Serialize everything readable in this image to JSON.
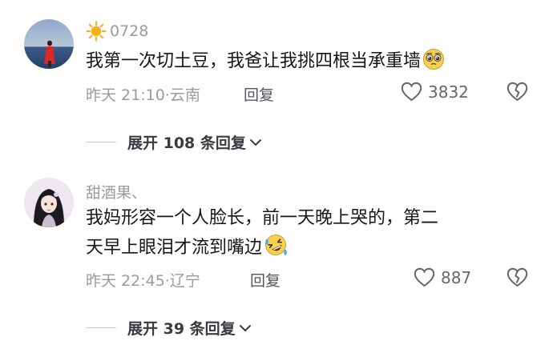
{
  "comments": [
    {
      "username": "0728",
      "username_icon": "sun-icon",
      "text": "我第一次切土豆，我爸让我挑四根当承重墙",
      "trailing_emoji": "pleading-face-emoji",
      "time": "昨天 21:10",
      "location": "云南",
      "reply_label": "回复",
      "likes": "3832",
      "expand_label": "展开 108 条回复"
    },
    {
      "username": "甜酒果、",
      "text_line1": "我妈形容一个人脸长，前一天晚上哭的，第二",
      "text_line2": "天早上眼泪才流到嘴边",
      "trailing_emoji": "rolling-laughing-emoji",
      "time": "昨天 22:45",
      "location": "辽宁",
      "reply_label": "回复",
      "likes": "887",
      "expand_label": "展开 39 条回复"
    }
  ],
  "colors": {
    "muted": "#9a9aa0",
    "text": "#161616",
    "accent_sun": "#f6b21a"
  }
}
